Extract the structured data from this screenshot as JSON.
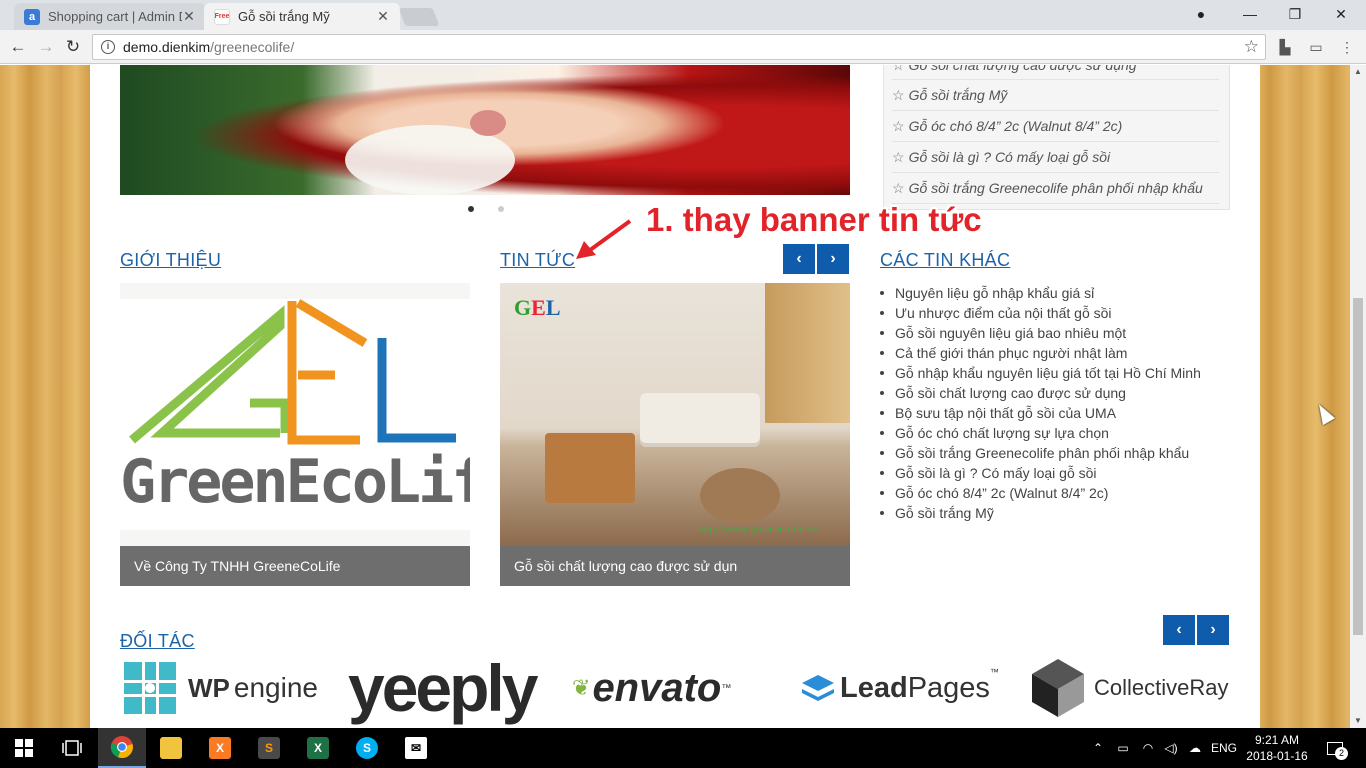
{
  "browser": {
    "tabs": [
      {
        "title": "Shopping cart | Admin D",
        "favicon": "a",
        "active": false
      },
      {
        "title": "Gỗ sồi trắng Mỹ",
        "favicon": "Free",
        "active": true
      }
    ],
    "address": {
      "domain": "demo.dienkim",
      "path": "/greenecolife/"
    }
  },
  "sidebar_posts": {
    "items": [
      "Gỗ sồi chất lượng cao được sử dụng",
      "Gỗ sồi trắng Mỹ",
      "Gỗ óc chó 8/4” 2c (Walnut 8/4” 2c)",
      "Gỗ sồi là gì ? Có mấy loại gỗ sồi",
      "Gỗ sồi trắng Greenecolife phân phối nhập khẩu"
    ]
  },
  "sections": {
    "intro": {
      "title": "GIỚI THIỆU",
      "caption": "Về Công Ty TNHH GreeneCoLife",
      "logo_text": "GreenEcoLife"
    },
    "news": {
      "title": "TIN TỨC",
      "caption": "Gỗ sồi chất lượng cao được sử dụn",
      "watermark": "GEL",
      "site_url": "http://www.greenecolife.vn"
    },
    "other_news": {
      "title": "CÁC TIN KHÁC",
      "items": [
        "Nguyên liệu gỗ nhập khẩu giá sỉ",
        "Ưu nhược điểm của nội thất gỗ sồi",
        "Gỗ sồi nguyên liệu giá bao nhiêu một",
        "Cả thế giới thán phục người nhật làm",
        "Gỗ nhập khẩu nguyên liệu giá tốt tại Hồ Chí Minh",
        "Gỗ sồi chất lượng cao được sử dụng",
        "Bộ sưu tập nội thất gỗ sồi của UMA",
        "Gỗ óc chó chất lượng sự lựa chọn",
        "Gỗ sồi trắng Greenecolife phân phối nhập khẩu",
        "Gỗ sồi là gì ? Có mấy loại gỗ sồi",
        "Gỗ óc chó 8/4” 2c (Walnut 8/4” 2c)",
        "Gỗ sồi trắng Mỹ"
      ]
    },
    "partners": {
      "title": "ĐỐI TÁC",
      "logos": [
        {
          "name": "wpengine",
          "text_a": "WP",
          "text_b": "engine"
        },
        {
          "name": "yeeply",
          "text": "yeeply"
        },
        {
          "name": "envato",
          "text": "envato",
          "tm": "™"
        },
        {
          "name": "leadpages",
          "text_a": "Lead",
          "text_b": "Pages",
          "tm": "™"
        },
        {
          "name": "collectiveray",
          "text": "CollectiveRay"
        }
      ]
    }
  },
  "annotation": {
    "text": "1. thay banner tin tức",
    "color": "#e3232a"
  },
  "arrows": {
    "prev": "‹",
    "next": "›"
  },
  "taskbar": {
    "language": "ENG",
    "time": "9:21 AM",
    "date": "2018-01-16",
    "notifications": "2"
  },
  "colors": {
    "accent": "#1e63a8",
    "arrow_button": "#0f5cad",
    "caption_bg": "#6e6e6e"
  }
}
